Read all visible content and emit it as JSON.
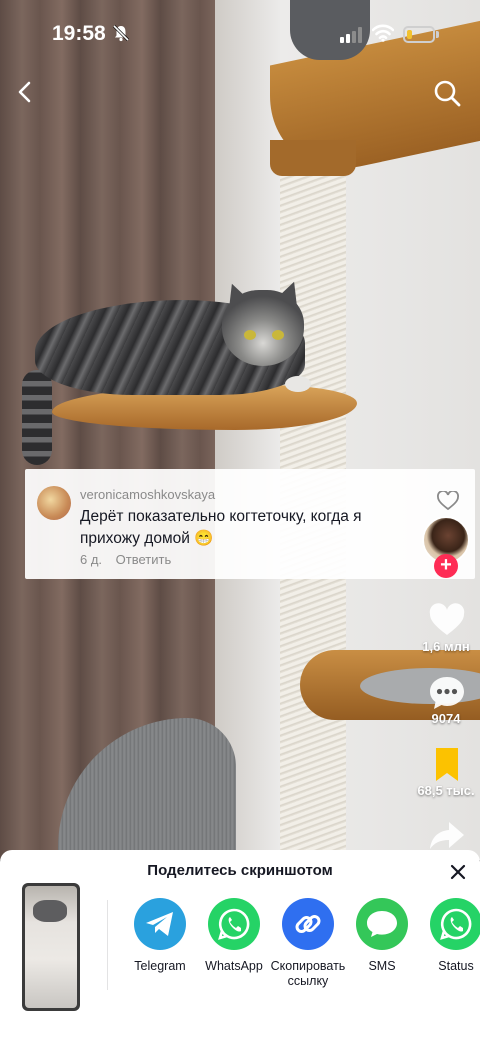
{
  "status_bar": {
    "time": "19:58",
    "battery_level": 0.2,
    "battery_color": "#f2c230"
  },
  "nav": {
    "back_icon": "chevron-left-icon",
    "search_icon": "search-icon"
  },
  "comment": {
    "username": "veronicamoshkovskaya",
    "text": "Дерёт показательно когтеточку, когда я прихожу домой 😁",
    "age": "6 д.",
    "reply_label": "Ответить"
  },
  "actions": {
    "likes": "1,6 млн",
    "comments": "9074",
    "saves": "68,5 тыс.",
    "accent_color": "#fe2c55",
    "save_color": "#fcc200"
  },
  "share_sheet": {
    "title": "Поделитесь скриншотом",
    "items": [
      {
        "label": "Telegram",
        "color": "#2aa1de",
        "icon": "telegram-icon"
      },
      {
        "label": "WhatsApp",
        "color": "#25d366",
        "icon": "whatsapp-icon"
      },
      {
        "label": "Скопировать ссылку",
        "color": "#2f6ff0",
        "icon": "link-icon"
      },
      {
        "label": "SMS",
        "color": "#34c759",
        "icon": "sms-icon"
      },
      {
        "label": "Status",
        "color": "#25d366",
        "icon": "whatsapp-status-icon"
      }
    ]
  }
}
